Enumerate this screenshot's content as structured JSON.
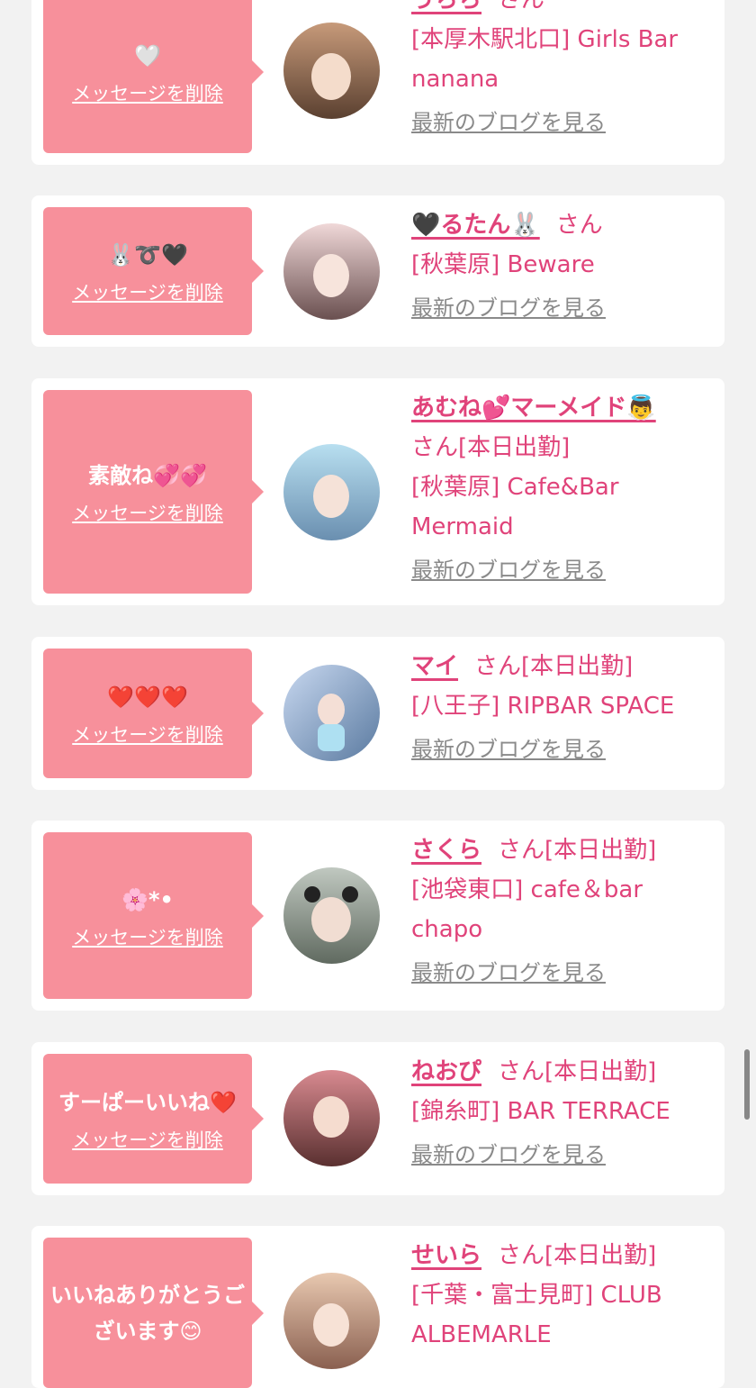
{
  "delete_label": "メッセージを削除",
  "blog_label": "最新のブログを見る",
  "san_label": "さん",
  "cards": [
    {
      "message": "🤍",
      "name": "うらら",
      "status": "",
      "store": "[本厚木駅北口] Girls Bar nanana",
      "avatar_colors": [
        "#c79a7a",
        "#5a4030"
      ]
    },
    {
      "message": "🐰➰🖤",
      "name": "🖤るたん🐰",
      "status": "",
      "store": "[秋葉原] Beware",
      "avatar_colors": [
        "#f0d8d8",
        "#6a5050"
      ]
    },
    {
      "message": "素敵ね💞💞",
      "name": "あむね💕マーメイド👼",
      "status": "[本日出勤]",
      "store": "[秋葉原] Cafe&Bar Mermaid",
      "avatar_colors": [
        "#b8dff0",
        "#6a8fb0"
      ]
    },
    {
      "message": "❤️❤️❤️",
      "name": "マイ",
      "status": "[本日出勤]",
      "store": "[八王子] RIPBAR SPACE",
      "avatar_colors": [
        "#c8d8f0",
        "#5a7aa0"
      ]
    },
    {
      "message": "🌸*•",
      "name": "さくら",
      "status": "[本日出勤]",
      "store": "[池袋東口] cafe＆bar chapo",
      "avatar_colors": [
        "#c0c8c0",
        "#606a60"
      ]
    },
    {
      "message": "すーぱーいいね❤️",
      "name": "ねおぴ",
      "status": "[本日出勤]",
      "store": "[錦糸町] BAR TERRACE",
      "avatar_colors": [
        "#d88a90",
        "#5a3030"
      ]
    },
    {
      "message": "いいねありがとうございます😊",
      "name": "せいら",
      "status": "[本日出勤]",
      "store": "[千葉・富士見町] CLUB ALBEMARLE",
      "avatar_colors": [
        "#e8c8b0",
        "#8a6050"
      ]
    }
  ]
}
